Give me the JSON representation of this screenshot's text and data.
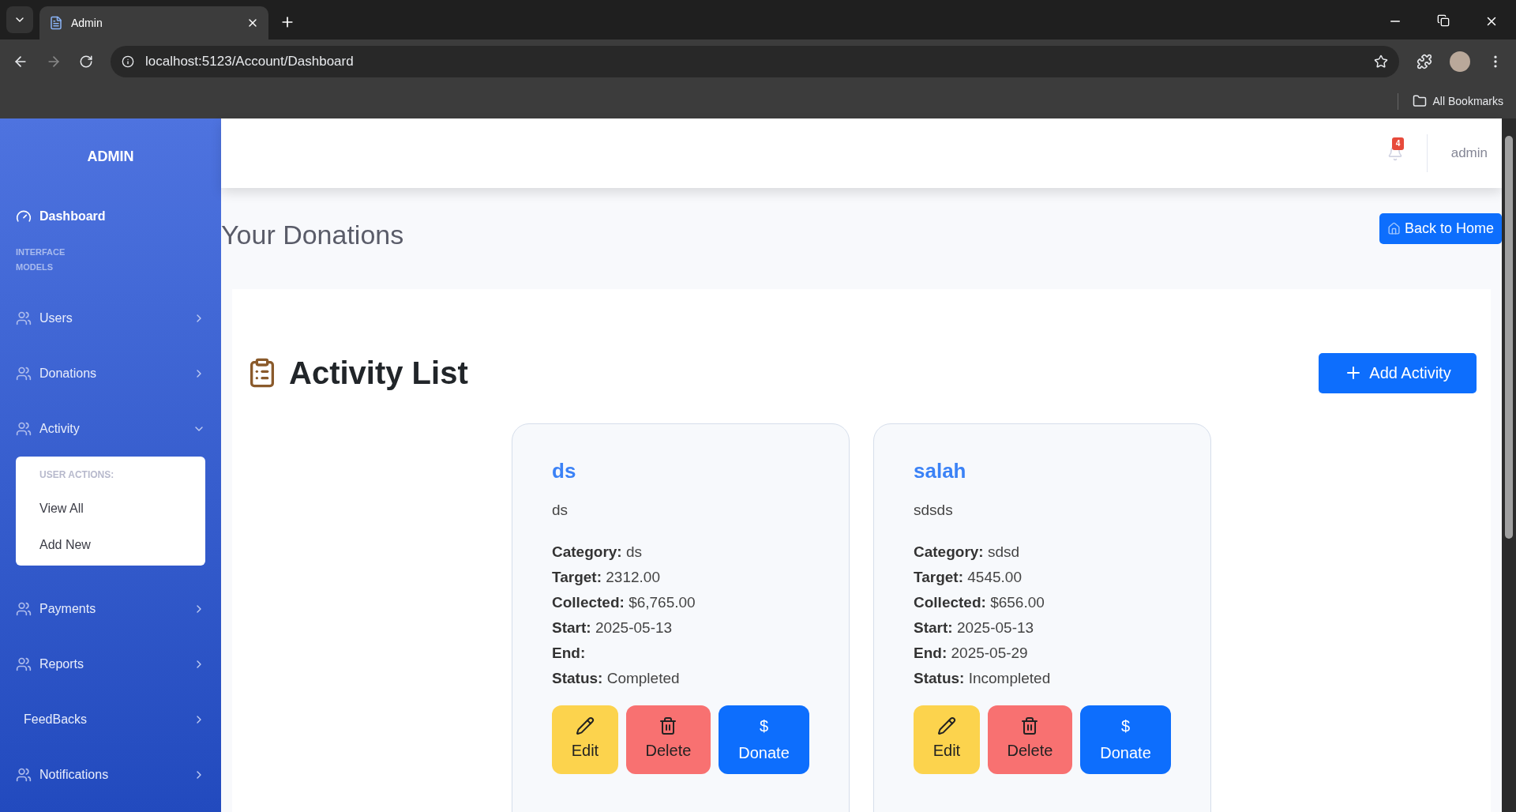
{
  "browser": {
    "tab_title": "Admin",
    "url": "localhost:5123/Account/Dashboard",
    "bookmarks_label": "All Bookmarks"
  },
  "sidebar": {
    "brand": "ADMIN",
    "dashboard": "Dashboard",
    "section_label": "INTERFACE MODELS",
    "items": [
      {
        "label": "Users",
        "has_icon": true,
        "expanded": false
      },
      {
        "label": "Donations",
        "has_icon": true,
        "expanded": false
      },
      {
        "label": "Activity",
        "has_icon": true,
        "expanded": true,
        "submenu": {
          "heading": "USER ACTIONS:",
          "items": [
            "View All",
            "Add New"
          ]
        }
      },
      {
        "label": "Payments",
        "has_icon": true,
        "expanded": false
      },
      {
        "label": "Reports",
        "has_icon": true,
        "expanded": false
      },
      {
        "label": "FeedBacks",
        "has_icon": false,
        "expanded": false
      },
      {
        "label": "Notifications",
        "has_icon": true,
        "expanded": false
      }
    ]
  },
  "header": {
    "notification_count": "4",
    "user": "admin"
  },
  "page_title": "Your Donations",
  "back_button": "Back to Home",
  "panel": {
    "heading": "Activity List",
    "add_button": "Add Activity",
    "activities": [
      {
        "title": "ds",
        "description": "ds",
        "fields": [
          {
            "label": "Category:",
            "value": "ds"
          },
          {
            "label": "Target:",
            "value": "2312.00"
          },
          {
            "label": "Collected:",
            "value": "$6,765.00"
          },
          {
            "label": "Start:",
            "value": "2025-05-13"
          },
          {
            "label": "End:"
          },
          {
            "label": "Status:",
            "value": "Completed"
          }
        ],
        "actions": [
          {
            "kind": "edit",
            "label": "Edit"
          },
          {
            "kind": "delete",
            "label": "Delete"
          },
          {
            "kind": "donate",
            "symbol": "$",
            "label": "Donate"
          }
        ]
      },
      {
        "title": "salah",
        "description": "sdsds",
        "fields": [
          {
            "label": "Category:",
            "value": "sdsd"
          },
          {
            "label": "Target:",
            "value": "4545.00"
          },
          {
            "label": "Collected:",
            "value": "$656.00"
          },
          {
            "label": "Start:",
            "value": "2025-05-13"
          },
          {
            "label": "End:",
            "value": "2025-05-29"
          },
          {
            "label": "Status:",
            "value": "Incompleted"
          }
        ],
        "actions": [
          {
            "kind": "edit",
            "label": "Edit"
          },
          {
            "kind": "delete",
            "label": "Delete"
          },
          {
            "kind": "donate",
            "symbol": "$",
            "label": "Donate"
          }
        ]
      }
    ]
  }
}
